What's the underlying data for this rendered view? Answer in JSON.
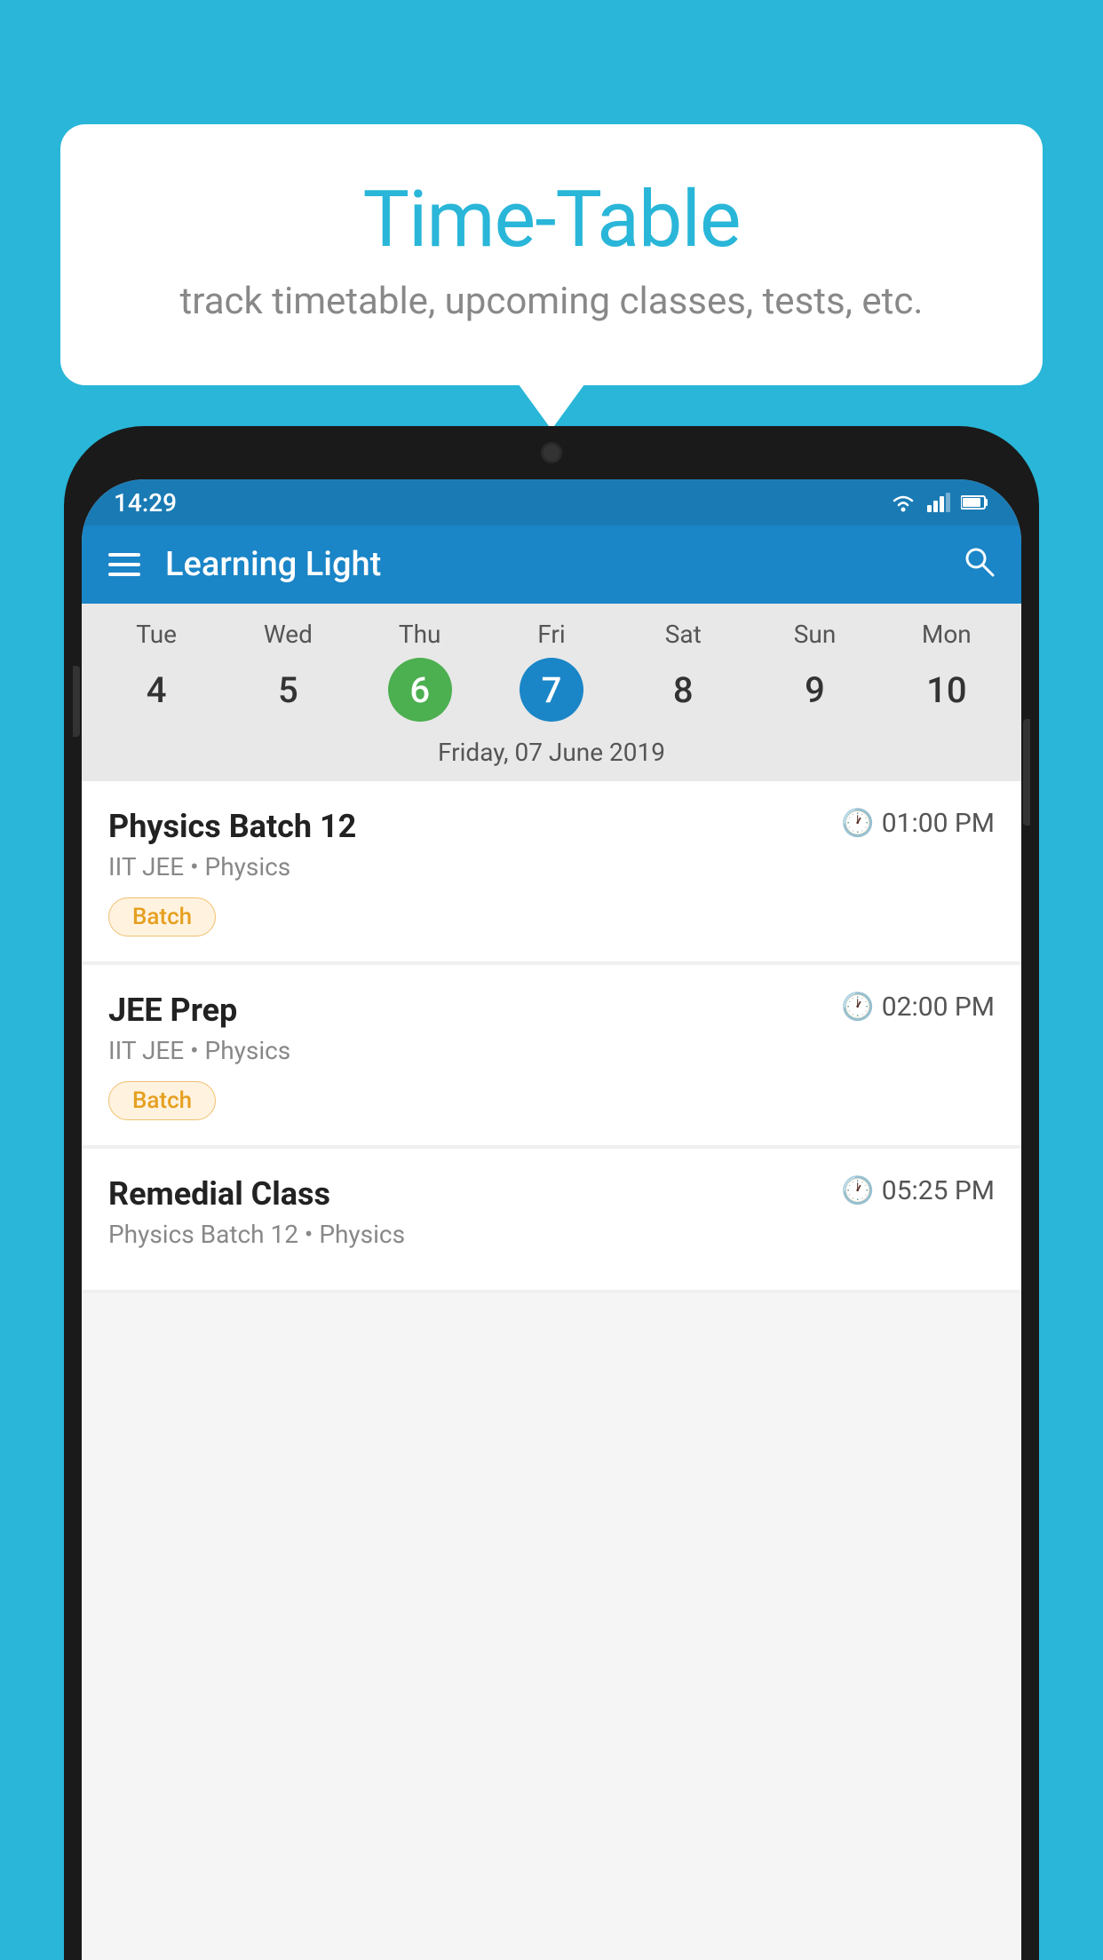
{
  "background_color": "#29b6d8",
  "bubble": {
    "title": "Time-Table",
    "subtitle": "track timetable, upcoming classes, tests, etc."
  },
  "status_bar": {
    "time": "14:29"
  },
  "app_bar": {
    "title": "Learning Light"
  },
  "calendar": {
    "selected_date_label": "Friday, 07 June 2019",
    "days": [
      {
        "label": "Tue",
        "number": "4",
        "state": "normal"
      },
      {
        "label": "Wed",
        "number": "5",
        "state": "normal"
      },
      {
        "label": "Thu",
        "number": "6",
        "state": "today"
      },
      {
        "label": "Fri",
        "number": "7",
        "state": "selected"
      },
      {
        "label": "Sat",
        "number": "8",
        "state": "normal"
      },
      {
        "label": "Sun",
        "number": "9",
        "state": "normal"
      },
      {
        "label": "Mon",
        "number": "10",
        "state": "normal"
      }
    ]
  },
  "schedule": {
    "items": [
      {
        "title": "Physics Batch 12",
        "time": "01:00 PM",
        "subtitle": "IIT JEE • Physics",
        "badge": "Batch"
      },
      {
        "title": "JEE Prep",
        "time": "02:00 PM",
        "subtitle": "IIT JEE • Physics",
        "badge": "Batch"
      },
      {
        "title": "Remedial Class",
        "time": "05:25 PM",
        "subtitle": "Physics Batch 12 • Physics",
        "badge": null
      }
    ]
  }
}
